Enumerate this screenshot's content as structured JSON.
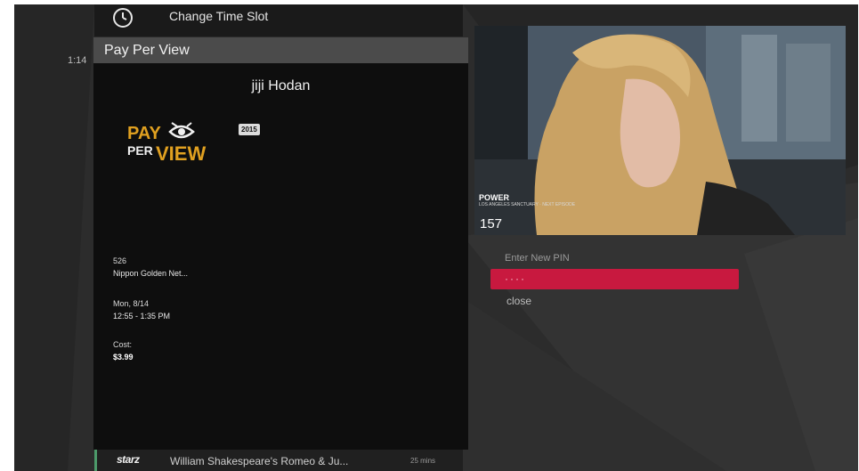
{
  "top_bar": {
    "change_slot_label": "Change Time Slot",
    "side_time": "1:14"
  },
  "ppv_panel": {
    "header_title": "Pay Per View",
    "program_title": "jiji Hodan",
    "logo_text_top": "PAY",
    "logo_text_bottom": "VIEW",
    "logo_text_per": "PER",
    "year_badge": "2015",
    "channel_number": "526",
    "channel_name": "Nippon Golden Net...",
    "air_date": "Mon, 8/14",
    "air_time": "12:55 - 1:35 PM",
    "cost_label": "Cost:",
    "cost_value": "$3.99"
  },
  "listing": {
    "network_logo": "starz",
    "title": "William Shakespeare's Romeo & Ju...",
    "duration": "25 mins"
  },
  "preview": {
    "network_logo": "POWER",
    "network_sub": "LOS ANGELES SANCTUARY · NEXT EPISODE",
    "channel_number": "157"
  },
  "pin": {
    "label": "Enter New PIN",
    "value": "····",
    "close_label": "close"
  },
  "colors": {
    "accent_red": "#c8193f",
    "ppv_orange": "#e0a020",
    "panel_bg": "#0e0e0e",
    "header_bg": "#4b4b4b"
  }
}
